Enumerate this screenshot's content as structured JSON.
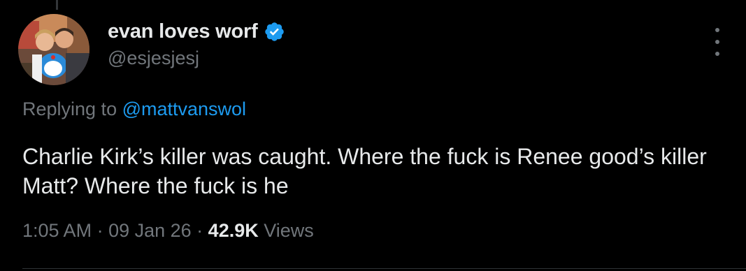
{
  "author": {
    "display_name": "evan loves worf",
    "handle": "@esjesjesj",
    "verified_icon": "verified-badge-icon",
    "verified_color": "#1d9bf0"
  },
  "reply": {
    "prefix": "Replying to ",
    "mention": "@mattvanswol"
  },
  "tweet": {
    "text": "Charlie Kirk’s killer was caught. Where the fuck is Renee good’s killer Matt? Where the fuck is he"
  },
  "meta": {
    "time": "1:05 AM",
    "separator": " · ",
    "date": "09 Jan 26",
    "views_count": "42.9K",
    "views_label": " Views"
  },
  "icons": {
    "more": "more-options-icon"
  },
  "colors": {
    "background": "#000000",
    "primary_text": "#e7e9ea",
    "secondary_text": "#71767b",
    "accent": "#1d9bf0"
  }
}
